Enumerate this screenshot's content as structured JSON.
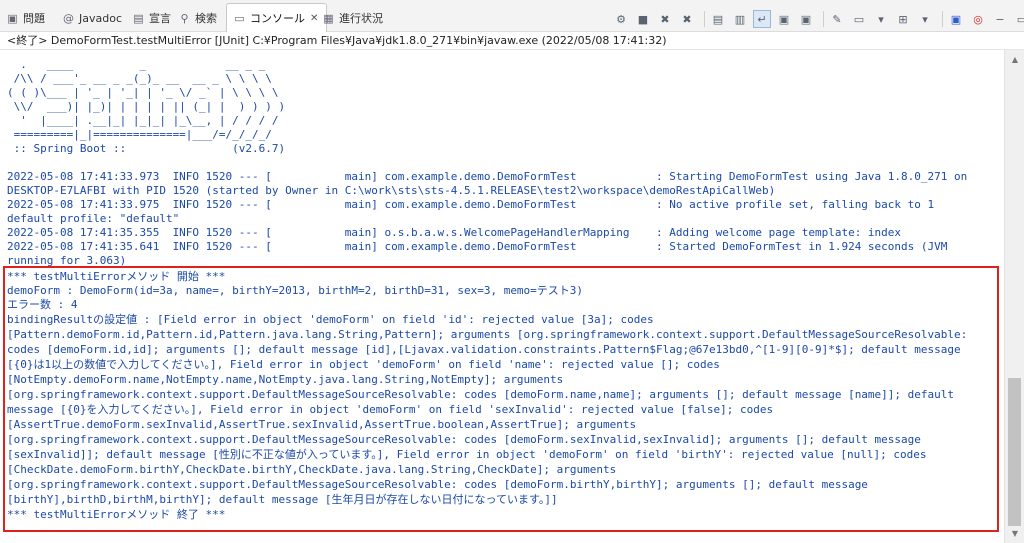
{
  "tabs": [
    {
      "label": "問題",
      "icon": "problems-icon"
    },
    {
      "label": "Javadoc",
      "icon": "at-sign-icon"
    },
    {
      "label": "宣言",
      "icon": "declaration-icon"
    },
    {
      "label": "検索",
      "icon": "flashlight-icon"
    },
    {
      "label": "コンソール",
      "icon": "console-icon",
      "active": true,
      "close": "✕"
    },
    {
      "label": "進行状況",
      "icon": "progress-icon"
    }
  ],
  "toolbar_icons": [
    "pin-icon",
    "stop-icon",
    "remove-launch-icon",
    "remove-all-launches-icon",
    "clear-console-icon",
    "scroll-lock-icon",
    "word-wrap-icon",
    "show-on-output-icon",
    "show-on-error-icon",
    "pin-console-icon",
    "display-console-icon",
    "open-console-icon",
    "new-console-icon",
    "maximize-icon",
    "minimize-icon"
  ],
  "status": "<終了> DemoFormTest.testMultiError [JUnit] C:¥Program Files¥Java¥jdk1.8.0_271¥bin¥javaw.exe (2022/05/08 17:41:32)",
  "console_lines": [
    "  .   ____          _            __ _ _",
    " /\\\\ / ___'_ __ _ _(_)_ __  __ _ \\ \\ \\ \\",
    "( ( )\\___ | '_ | '_| | '_ \\/ _` | \\ \\ \\ \\",
    " \\\\/  ___)| |_)| | | | | || (_| |  ) ) ) )",
    "  '  |____| .__|_| |_|_| |_\\__, | / / / /",
    " =========|_|==============|___/=/_/_/_/",
    " :: Spring Boot ::                (v2.6.7)",
    "",
    "2022-05-08 17:41:33.973  INFO 1520 --- [           main] com.example.demo.DemoFormTest            : Starting DemoFormTest using Java 1.8.0_271 on",
    "DESKTOP-E7LAFBI with PID 1520 (started by Owner in C:\\work\\sts\\sts-4.5.1.RELEASE\\test2\\workspace\\demoRestApiCallWeb)",
    "2022-05-08 17:41:33.975  INFO 1520 --- [           main] com.example.demo.DemoFormTest            : No active profile set, falling back to 1",
    "default profile: \"default\"",
    "2022-05-08 17:41:35.355  INFO 1520 --- [           main] o.s.b.a.w.s.WelcomePageHandlerMapping    : Adding welcome page template: index",
    "2022-05-08 17:41:35.641  INFO 1520 --- [           main] com.example.demo.DemoFormTest            : Started DemoFormTest in 1.924 seconds (JVM",
    "running for 3.063)",
    "*** testMultiErrorメソッド 開始 ***",
    "demoForm : DemoForm(id=3a, name=, birthY=2013, birthM=2, birthD=31, sex=3, memo=テスト3)",
    "エラー数 : 4",
    "bindingResultの設定値 : [Field error in object 'demoForm' on field 'id': rejected value [3a]; codes",
    "[Pattern.demoForm.id,Pattern.id,Pattern.java.lang.String,Pattern]; arguments [org.springframework.context.support.DefaultMessageSourceResolvable:",
    "codes [demoForm.id,id]; arguments []; default message [id],[Ljavax.validation.constraints.Pattern$Flag;@67e13bd0,^[1-9][0-9]*$]; default message",
    "[{0}は1以上の数値で入力してください。], Field error in object 'demoForm' on field 'name': rejected value []; codes",
    "[NotEmpty.demoForm.name,NotEmpty.name,NotEmpty.java.lang.String,NotEmpty]; arguments",
    "[org.springframework.context.support.DefaultMessageSourceResolvable: codes [demoForm.name,name]; arguments []; default message [name]]; default",
    "message [{0}を入力してください。], Field error in object 'demoForm' on field 'sexInvalid': rejected value [false]; codes",
    "[AssertTrue.demoForm.sexInvalid,AssertTrue.sexInvalid,AssertTrue.boolean,AssertTrue]; arguments",
    "[org.springframework.context.support.DefaultMessageSourceResolvable: codes [demoForm.sexInvalid,sexInvalid]; arguments []; default message",
    "[sexInvalid]]; default message [性別に不正な値が入っています。], Field error in object 'demoForm' on field 'birthY': rejected value [null]; codes",
    "[CheckDate.demoForm.birthY,CheckDate.birthY,CheckDate.java.lang.String,CheckDate]; arguments",
    "[org.springframework.context.support.DefaultMessageSourceResolvable: codes [demoForm.birthY,birthY]; arguments []; default message",
    "[birthY],birthD,birthM,birthY]; default message [生年月日が存在しない日付になっています。]]",
    "*** testMultiErrorメソッド 終了 ***"
  ],
  "scrollbar": {
    "up": "▲",
    "down": "▼"
  },
  "colors": {
    "console_text": "#1c49a8",
    "highlight_border": "#e0221c"
  }
}
